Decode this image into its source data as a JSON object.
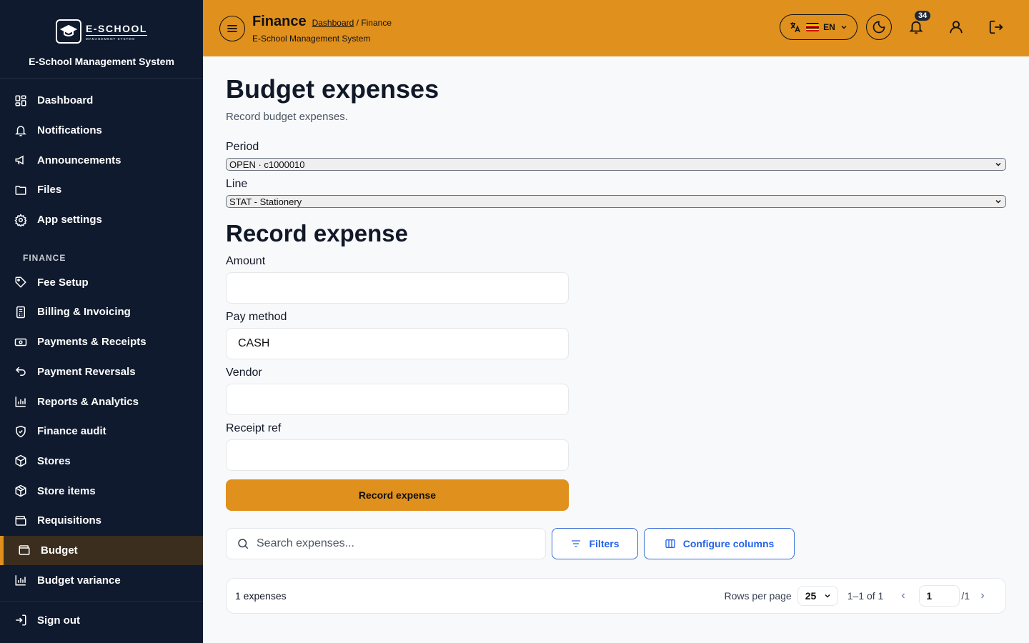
{
  "sidebar": {
    "logo_main": "E-SCHOOL",
    "logo_sub": "MANAGEMENT SYSTEM",
    "app_name": "E-School Management System",
    "items": [
      {
        "label": "Dashboard",
        "icon": "dashboard-icon"
      },
      {
        "label": "Notifications",
        "icon": "bell-icon"
      },
      {
        "label": "Announcements",
        "icon": "megaphone-icon"
      },
      {
        "label": "Files",
        "icon": "folder-icon"
      },
      {
        "label": "App settings",
        "icon": "gear-icon"
      }
    ],
    "section_finance": "FINANCE",
    "finance_items": [
      {
        "label": "Fee Setup",
        "icon": "tag-icon"
      },
      {
        "label": "Billing & Invoicing",
        "icon": "invoice-icon"
      },
      {
        "label": "Payments & Receipts",
        "icon": "money-icon"
      },
      {
        "label": "Payment Reversals",
        "icon": "undo-icon"
      },
      {
        "label": "Reports & Analytics",
        "icon": "bar-chart-icon"
      },
      {
        "label": "Finance audit",
        "icon": "shield-icon"
      },
      {
        "label": "Stores",
        "icon": "box-icon"
      },
      {
        "label": "Store items",
        "icon": "package-icon"
      },
      {
        "label": "Requisitions",
        "icon": "wallet-icon"
      },
      {
        "label": "Budget",
        "icon": "wallet-icon",
        "active": true
      },
      {
        "label": "Budget variance",
        "icon": "bar-chart-icon"
      }
    ],
    "sign_out": "Sign out"
  },
  "header": {
    "title": "Finance",
    "breadcrumb_link": "Dashboard",
    "breadcrumb_sep": " / ",
    "breadcrumb_current": "Finance",
    "subtitle": "E-School Management System",
    "lang": "EN",
    "notification_count": "34",
    "accent": "#e0901c"
  },
  "main": {
    "title": "Budget expenses",
    "subtitle": "Record budget expenses.",
    "period_label": "Period",
    "period_value": "OPEN · c1000010",
    "line_label": "Line",
    "line_value": "STAT - Stationery",
    "section_title": "Record expense",
    "amount_label": "Amount",
    "amount_value": "",
    "pay_method_label": "Pay method",
    "pay_method_value": "CASH",
    "vendor_label": "Vendor",
    "vendor_value": "",
    "receipt_label": "Receipt ref",
    "receipt_value": "",
    "submit_label": "Record expense",
    "search_placeholder": "Search expenses...",
    "filters_label": "Filters",
    "configure_label": "Configure columns",
    "count_text": "1 expenses",
    "rows_per_page_label": "Rows per page",
    "rows_per_page_value": "25",
    "range_text": "1–1 of 1",
    "page_value": "1",
    "page_total": "/1"
  }
}
